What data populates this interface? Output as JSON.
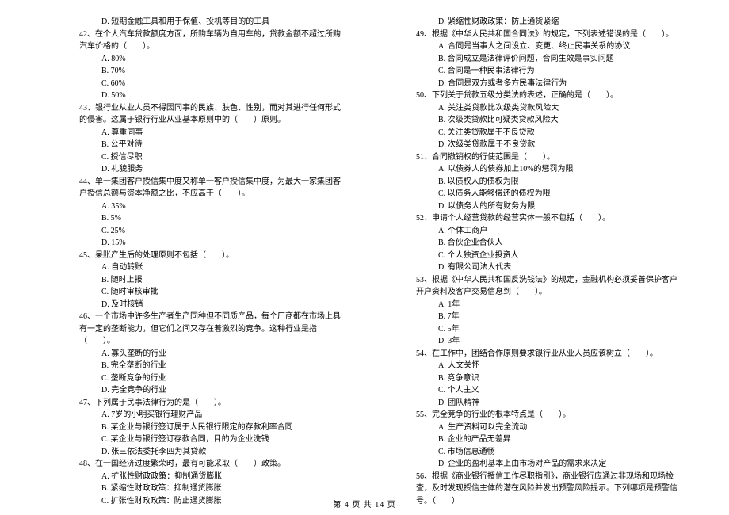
{
  "left": {
    "q41_d": "D. 短期金融工具和用于保值、投机等目的的工具",
    "q42": "42、在个人汽车贷款额度方面，所购车辆为自用车的，贷款金额不超过所购汽车价格的（　　）。",
    "q42_opts": [
      "A. 80%",
      "B. 70%",
      "C. 60%",
      "D. 50%"
    ],
    "q43": "43、银行业从业人员不得因同事的民族、肤色、性别，而对其进行任何形式的侵害。这属于银行行业从业基本原则中的（　　）原则。",
    "q43_opts": [
      "A. 尊重同事",
      "B. 公平对待",
      "C. 授信尽职",
      "D. 礼貌服务"
    ],
    "q44": "44、单一集团客户授信集中度又称单一客户授信集中度，为最大一家集团客户授信总额与资本净额之比，不应高于（　　）。",
    "q44_opts": [
      "A. 35%",
      "B. 5%",
      "C. 25%",
      "D. 15%"
    ],
    "q45": "45、呆账产生后的处理原则不包括（　　）。",
    "q45_opts": [
      "A. 自动转账",
      "B. 随时上报",
      "C. 随时审核审批",
      "D. 及时核销"
    ],
    "q46": "46、一个市场中许多生产者生产同种但不同质产品，每个厂商都在市场上具有一定的垄断能力，但它们之间又存在着激烈的竞争。这种行业是指（　　）。",
    "q46_opts": [
      "A. 寡头垄断的行业",
      "B. 完全垄断的行业",
      "C. 垄断竞争的行业",
      "D. 完全竞争的行业"
    ],
    "q47": "47、下列属于民事法律行为的是（　　）。",
    "q47_opts": [
      "A. 7岁的小明买银行理财产品",
      "B. 某企业与银行签订属于人民银行限定的存款利率合同",
      "C. 某企业与银行签订存款合同，目的为企业洗钱",
      "D. 张三依法委托李四为其贷款"
    ],
    "q48": "48、在一国经济过度繁荣时，最有可能采取（　　）政策。",
    "q48_opts": [
      "A. 扩张性财政政策：抑制通货膨胀",
      "B. 紧缩性财政政策：抑制通货膨胀",
      "C. 扩张性财政政策：防止通货膨胀"
    ]
  },
  "right": {
    "q48_d": "D. 紧缩性财政政策：防止通货紧缩",
    "q49": "49、根据《中华人民共和国合同法》的规定，下列表述错误的是（　　）。",
    "q49_opts": [
      "A. 合同是当事人之间设立、变更、终止民事关系的协议",
      "B. 合同成立是法律评价问题，合同生效是事实问题",
      "C. 合同是一种民事法律行为",
      "D. 合同是双方或者多方民事法律行为"
    ],
    "q50": "50、下列关于贷款五级分类法的表述，正确的是（　　）。",
    "q50_opts": [
      "A. 关注类贷款比次级类贷款风险大",
      "B. 次级类贷款比可疑类贷款风险大",
      "C. 关注类贷款属于不良贷款",
      "D. 次级类贷款属于不良贷款"
    ],
    "q51": "51、合同撤销权的行使范围是（　　）。",
    "q51_opts": [
      "A. 以债券人的债券加上10%的惩罚为限",
      "B. 以债权人的债权为限",
      "C. 以债务人能够偿还的债权为限",
      "D. 以债务人的所有财务为限"
    ],
    "q52": "52、申请个人经营贷款的经营实体一般不包括（　　）。",
    "q52_opts": [
      "A. 个体工商户",
      "B. 合伙企业合伙人",
      "C. 个人独资企业投资人",
      "D. 有限公司法人代表"
    ],
    "q53": "53、根据《中华人民共和国反洗钱法》的规定，金融机构必须妥善保护客户开户资料及客户交易信息到（　　）。",
    "q53_opts": [
      "A. 1年",
      "B. 7年",
      "C. 5年",
      "D. 3年"
    ],
    "q54": "54、在工作中，团结合作原则要求银行业从业人员应该树立（　　）。",
    "q54_opts": [
      "A. 人文关怀",
      "B. 竞争意识",
      "C. 个人主义",
      "D. 团队精神"
    ],
    "q55": "55、完全竞争的行业的根本特点是（　　）。",
    "q55_opts": [
      "A. 生产资料可以完全流动",
      "B. 企业的产品无差异",
      "C. 市场信息通畅",
      "D. 企业的盈利基本上由市场对产品的需求来决定"
    ],
    "q56": "56、根据《商业银行授信工作尽职指引》，商业银行应通过非现场和现场检查，及时发现授信主体的潜在风险并发出预警风险提示。下列哪项是预警信号。（　　）"
  },
  "footer": "第 4 页 共 14 页"
}
